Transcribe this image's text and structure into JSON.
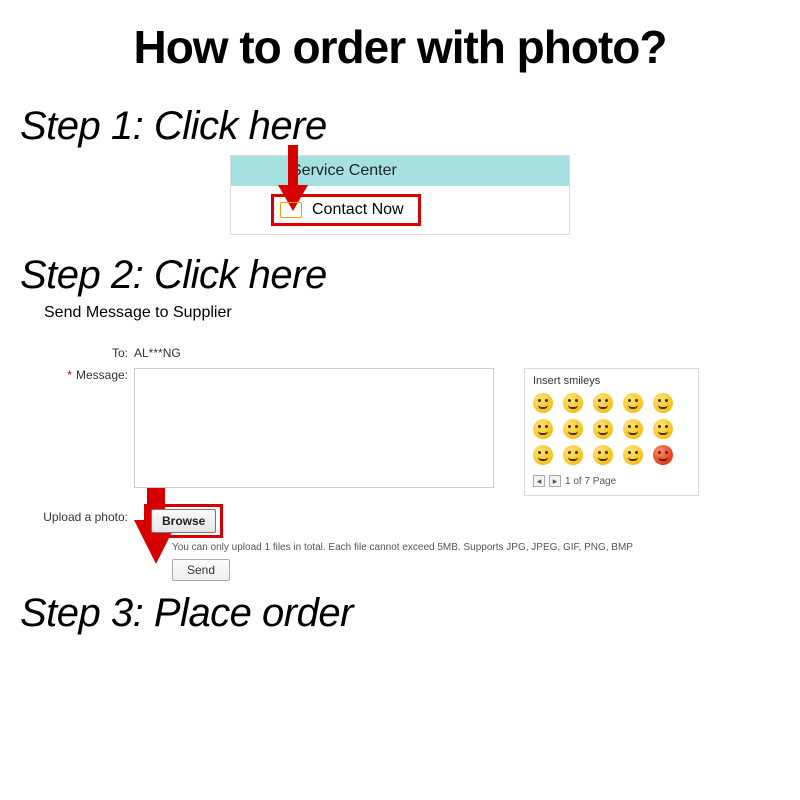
{
  "title": "How to order with photo?",
  "step1": {
    "label": "Step 1: Click here",
    "service_center": "Service Center",
    "contact_now": "Contact Now"
  },
  "step2": {
    "label": "Step 2: Click here",
    "send_title": "Send Message to Supplier",
    "to_label": "To:",
    "to_value": "AL***NG",
    "message_label": "Message:",
    "smileys_title": "Insert smileys",
    "pager_text": "1 of 7 Page",
    "upload_label": "Upload a photo:",
    "browse_label": "Browse",
    "upload_note": "You can only upload 1 files in total. Each file cannot exceed 5MB. Supports JPG, JPEG, GIF, PNG, BMP",
    "send_label": "Send"
  },
  "step3": {
    "label": "Step 3: Place order"
  }
}
